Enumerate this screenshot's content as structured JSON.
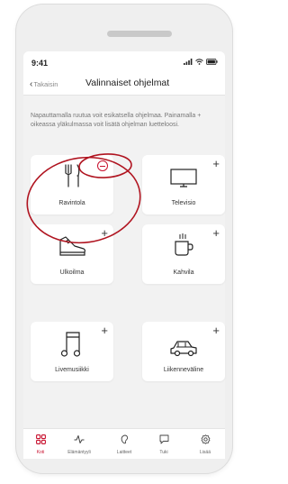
{
  "status_bar": {
    "time": "9:41"
  },
  "header": {
    "back_label": "Takaisin",
    "title": "Valinnaiset ohjelmat"
  },
  "description": "Napauttamalla ruutua voit esikatsella ohjelmaa. Painamalla + oikeassa yläkulmassa voit lisätä ohjelman luetteloosi.",
  "programs": [
    {
      "label": "Ravintola",
      "icon": "fork-knife-icon",
      "action": "remove"
    },
    {
      "label": "Televisio",
      "icon": "tv-icon",
      "action": "add"
    },
    {
      "label": "Ulkoilma",
      "icon": "shoe-icon",
      "action": "add"
    },
    {
      "label": "Kahvila",
      "icon": "coffee-cup-icon",
      "action": "add"
    },
    {
      "label": "Livemusiikki",
      "icon": "music-note-icon",
      "action": "add"
    },
    {
      "label": "Liikenneväline",
      "icon": "car-icon",
      "action": "add"
    }
  ],
  "tabs": [
    {
      "label": "Koti",
      "icon": "home-grid-icon",
      "active": true
    },
    {
      "label": "Elämäntyyli",
      "icon": "activity-icon",
      "active": false
    },
    {
      "label": "Laitteet",
      "icon": "hearing-aid-icon",
      "active": false
    },
    {
      "label": "Tuki",
      "icon": "chat-icon",
      "active": false
    },
    {
      "label": "Lisää",
      "icon": "gear-icon",
      "active": false
    }
  ],
  "colors": {
    "accent": "#c8102e",
    "background": "#f2f2f2",
    "card": "#ffffff"
  }
}
